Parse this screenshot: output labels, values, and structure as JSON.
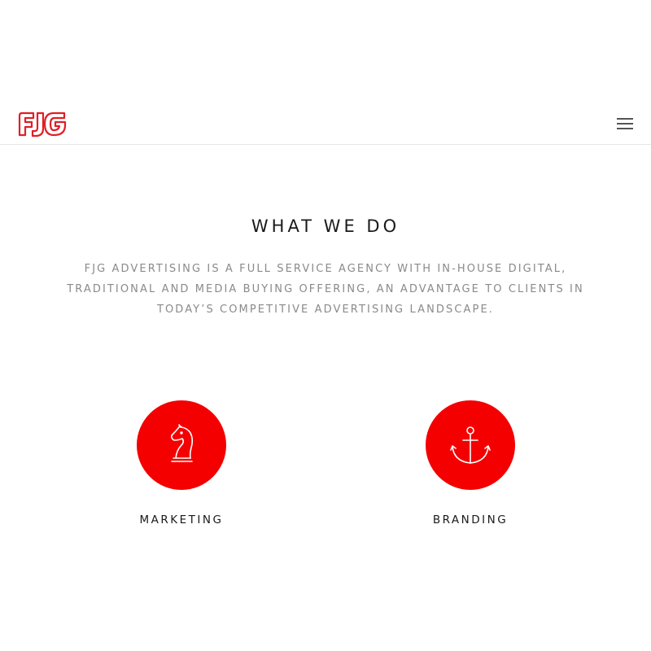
{
  "header": {
    "logo_text": "FJG",
    "menu_icon": "hamburger-menu-icon",
    "brand_color": "#e01f26"
  },
  "intro": {
    "title": "WHAT WE DO",
    "description": "FJG ADVERTISING IS A FULL SERVICE AGENCY WITH IN-HOUSE DIGITAL, TRADITIONAL AND MEDIA BUYING OFFERING, AN ADVANTAGE TO CLIENTS IN TODAY’S COMPETITIVE ADVERTISING LANDSCAPE."
  },
  "services": [
    {
      "label": "MARKETING",
      "icon": "chess-knight-icon"
    },
    {
      "label": "BRANDING",
      "icon": "anchor-icon"
    }
  ],
  "colors": {
    "accent": "#f40000",
    "text_dark": "#1a1a1a",
    "text_muted": "#8a8a8a",
    "divider": "#e6e6e6"
  }
}
